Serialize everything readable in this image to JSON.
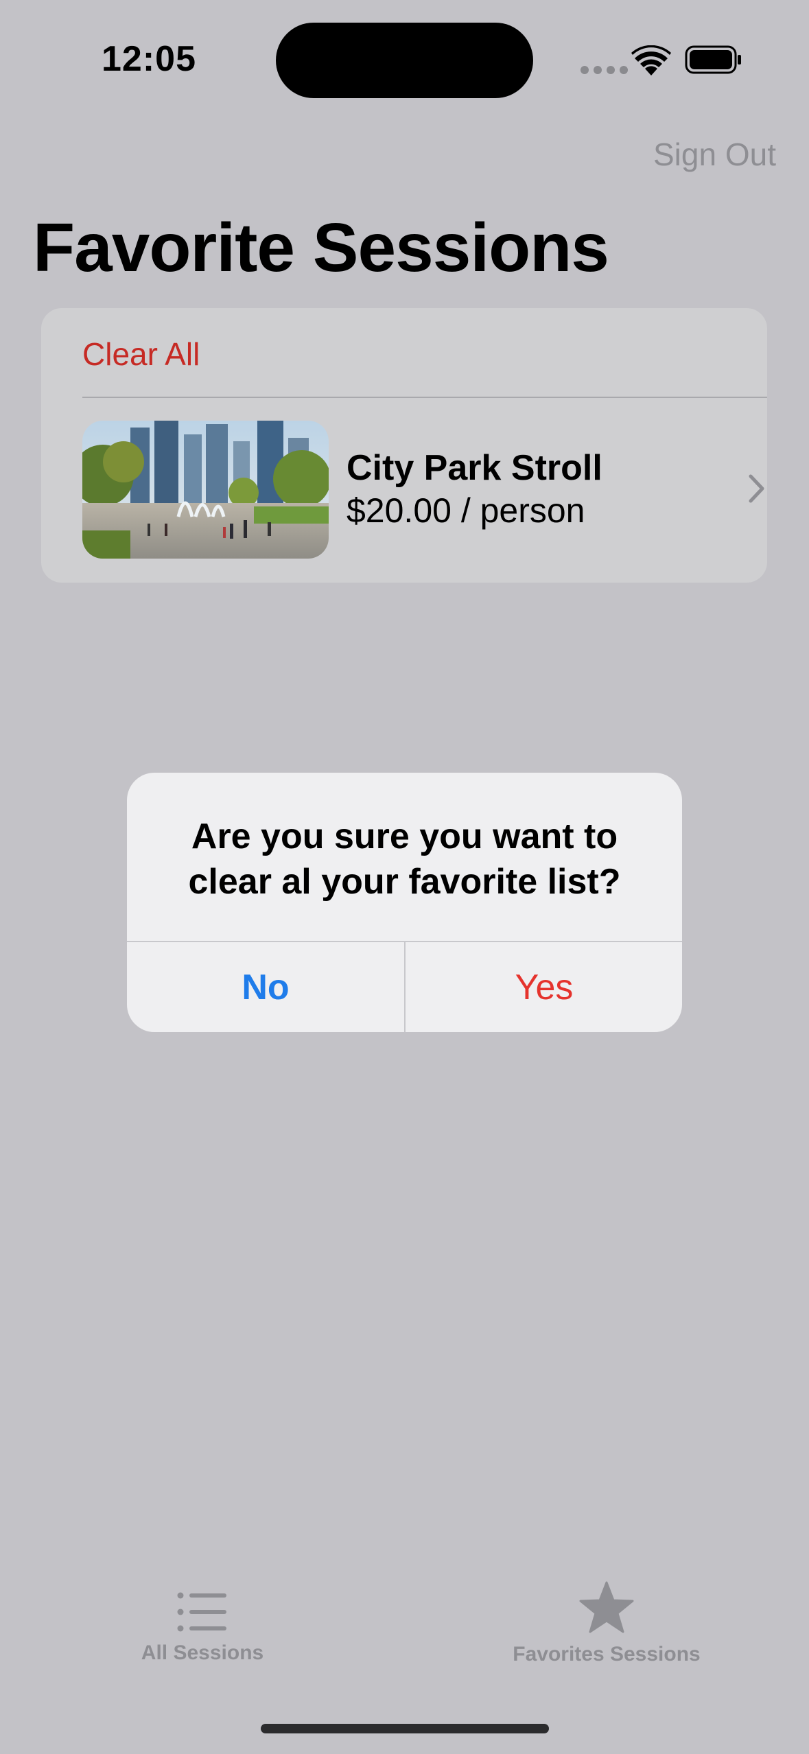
{
  "status_bar": {
    "time": "12:05"
  },
  "nav": {
    "sign_out_label": "Sign Out",
    "title": "Favorite Sessions"
  },
  "list": {
    "clear_all_label": "Clear All",
    "items": [
      {
        "title": "City Park Stroll",
        "price": "$20.00 / person",
        "image": "city-park-photo"
      }
    ]
  },
  "alert": {
    "message": "Are you sure you want to clear al your favorite list?",
    "no_label": "No",
    "yes_label": "Yes"
  },
  "tab_bar": {
    "tabs": [
      {
        "label": "All Sessions",
        "icon": "list-icon"
      },
      {
        "label": "Favorites Sessions",
        "icon": "star-icon"
      }
    ]
  },
  "colors": {
    "background": "#c3c2c7",
    "destructive": "#c62a24",
    "alert_yes": "#e5332d",
    "accent_blue": "#1f7cea",
    "secondary_text": "#8e8e93"
  }
}
